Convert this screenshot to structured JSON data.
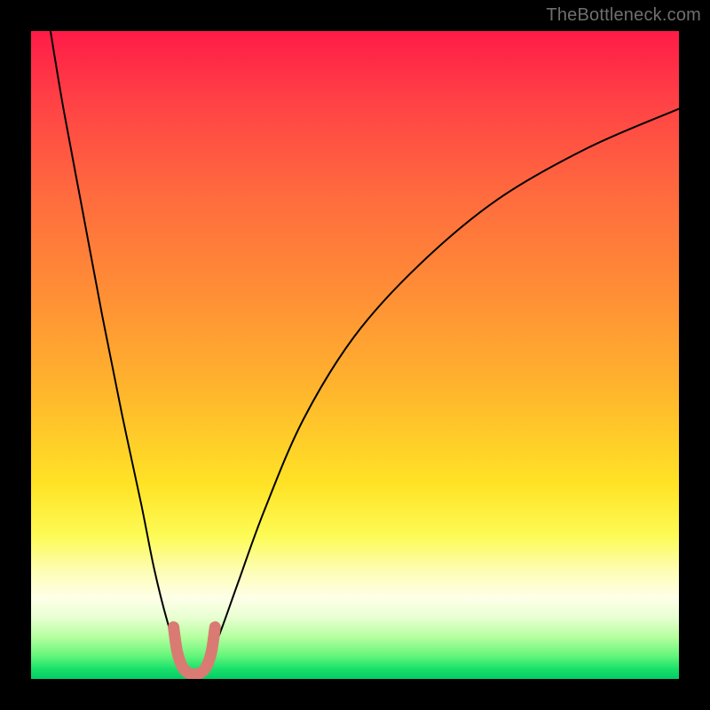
{
  "watermark": "TheBottleneck.com",
  "chart_data": {
    "type": "line",
    "title": "",
    "xlabel": "",
    "ylabel": "",
    "xlim": [
      0,
      100
    ],
    "ylim": [
      0,
      100
    ],
    "notes": "Bottleneck curve: minimum (optimal match) near x≈25, rising toward 100 on both sides. Background vertical gradient red→orange→yellow→green encodes penalty (top=worst, bottom=best). Short salmon U-shaped marker at the trough.",
    "gradient_stops": [
      {
        "offset": 0.0,
        "color": "#ff1b47"
      },
      {
        "offset": 0.1,
        "color": "#ff3f46"
      },
      {
        "offset": 0.25,
        "color": "#ff6a3e"
      },
      {
        "offset": 0.4,
        "color": "#ff8d36"
      },
      {
        "offset": 0.55,
        "color": "#ffb42d"
      },
      {
        "offset": 0.7,
        "color": "#ffe326"
      },
      {
        "offset": 0.78,
        "color": "#fdfb56"
      },
      {
        "offset": 0.83,
        "color": "#fdfdb0"
      },
      {
        "offset": 0.875,
        "color": "#feffe8"
      },
      {
        "offset": 0.905,
        "color": "#e8ffd2"
      },
      {
        "offset": 0.935,
        "color": "#b6ff9f"
      },
      {
        "offset": 0.965,
        "color": "#63f57a"
      },
      {
        "offset": 0.985,
        "color": "#17e06a"
      },
      {
        "offset": 1.0,
        "color": "#04cc66"
      }
    ],
    "series": [
      {
        "name": "bottleneck-curve",
        "x": [
          3,
          5,
          8,
          11,
          14,
          17,
          19,
          21,
          23,
          24.5,
          26,
          27.5,
          29.5,
          32,
          36,
          42,
          50,
          60,
          72,
          86,
          100
        ],
        "y": [
          100,
          88,
          72,
          56,
          41,
          27,
          17,
          9,
          3,
          0.5,
          0.5,
          3,
          8,
          15,
          26,
          40,
          53,
          64,
          74,
          82,
          88
        ]
      },
      {
        "name": "trough-marker",
        "x": [
          22.0,
          22.6,
          23.6,
          25.2,
          26.8,
          27.8,
          28.4
        ],
        "y": [
          8.0,
          4.0,
          1.5,
          0.7,
          1.5,
          4.0,
          8.0
        ]
      }
    ]
  }
}
